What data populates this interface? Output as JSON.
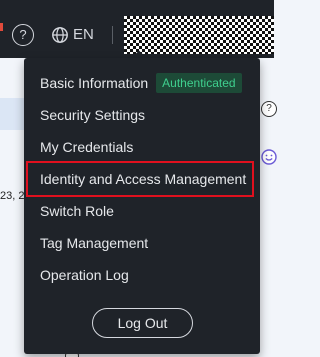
{
  "header": {
    "help_icon": "help-circle-icon",
    "help_glyph": "?",
    "language_icon": "globe-icon",
    "language_label": "EN",
    "account_avatar": "redacted"
  },
  "background": {
    "partial_text": "23, 2",
    "help_glyph": "?"
  },
  "account_menu": {
    "items": [
      {
        "label": "Basic Information",
        "badge": "Authenticated"
      },
      {
        "label": "Security Settings"
      },
      {
        "label": "My Credentials"
      },
      {
        "label": "Identity and Access Management",
        "highlighted": true
      },
      {
        "label": "Switch Role"
      },
      {
        "label": "Tag Management"
      },
      {
        "label": "Operation Log"
      }
    ],
    "logout_label": "Log Out"
  },
  "colors": {
    "topbar_bg": "#1f2329",
    "badge_text": "#3fcf8e",
    "highlight_border": "#e0101e"
  }
}
